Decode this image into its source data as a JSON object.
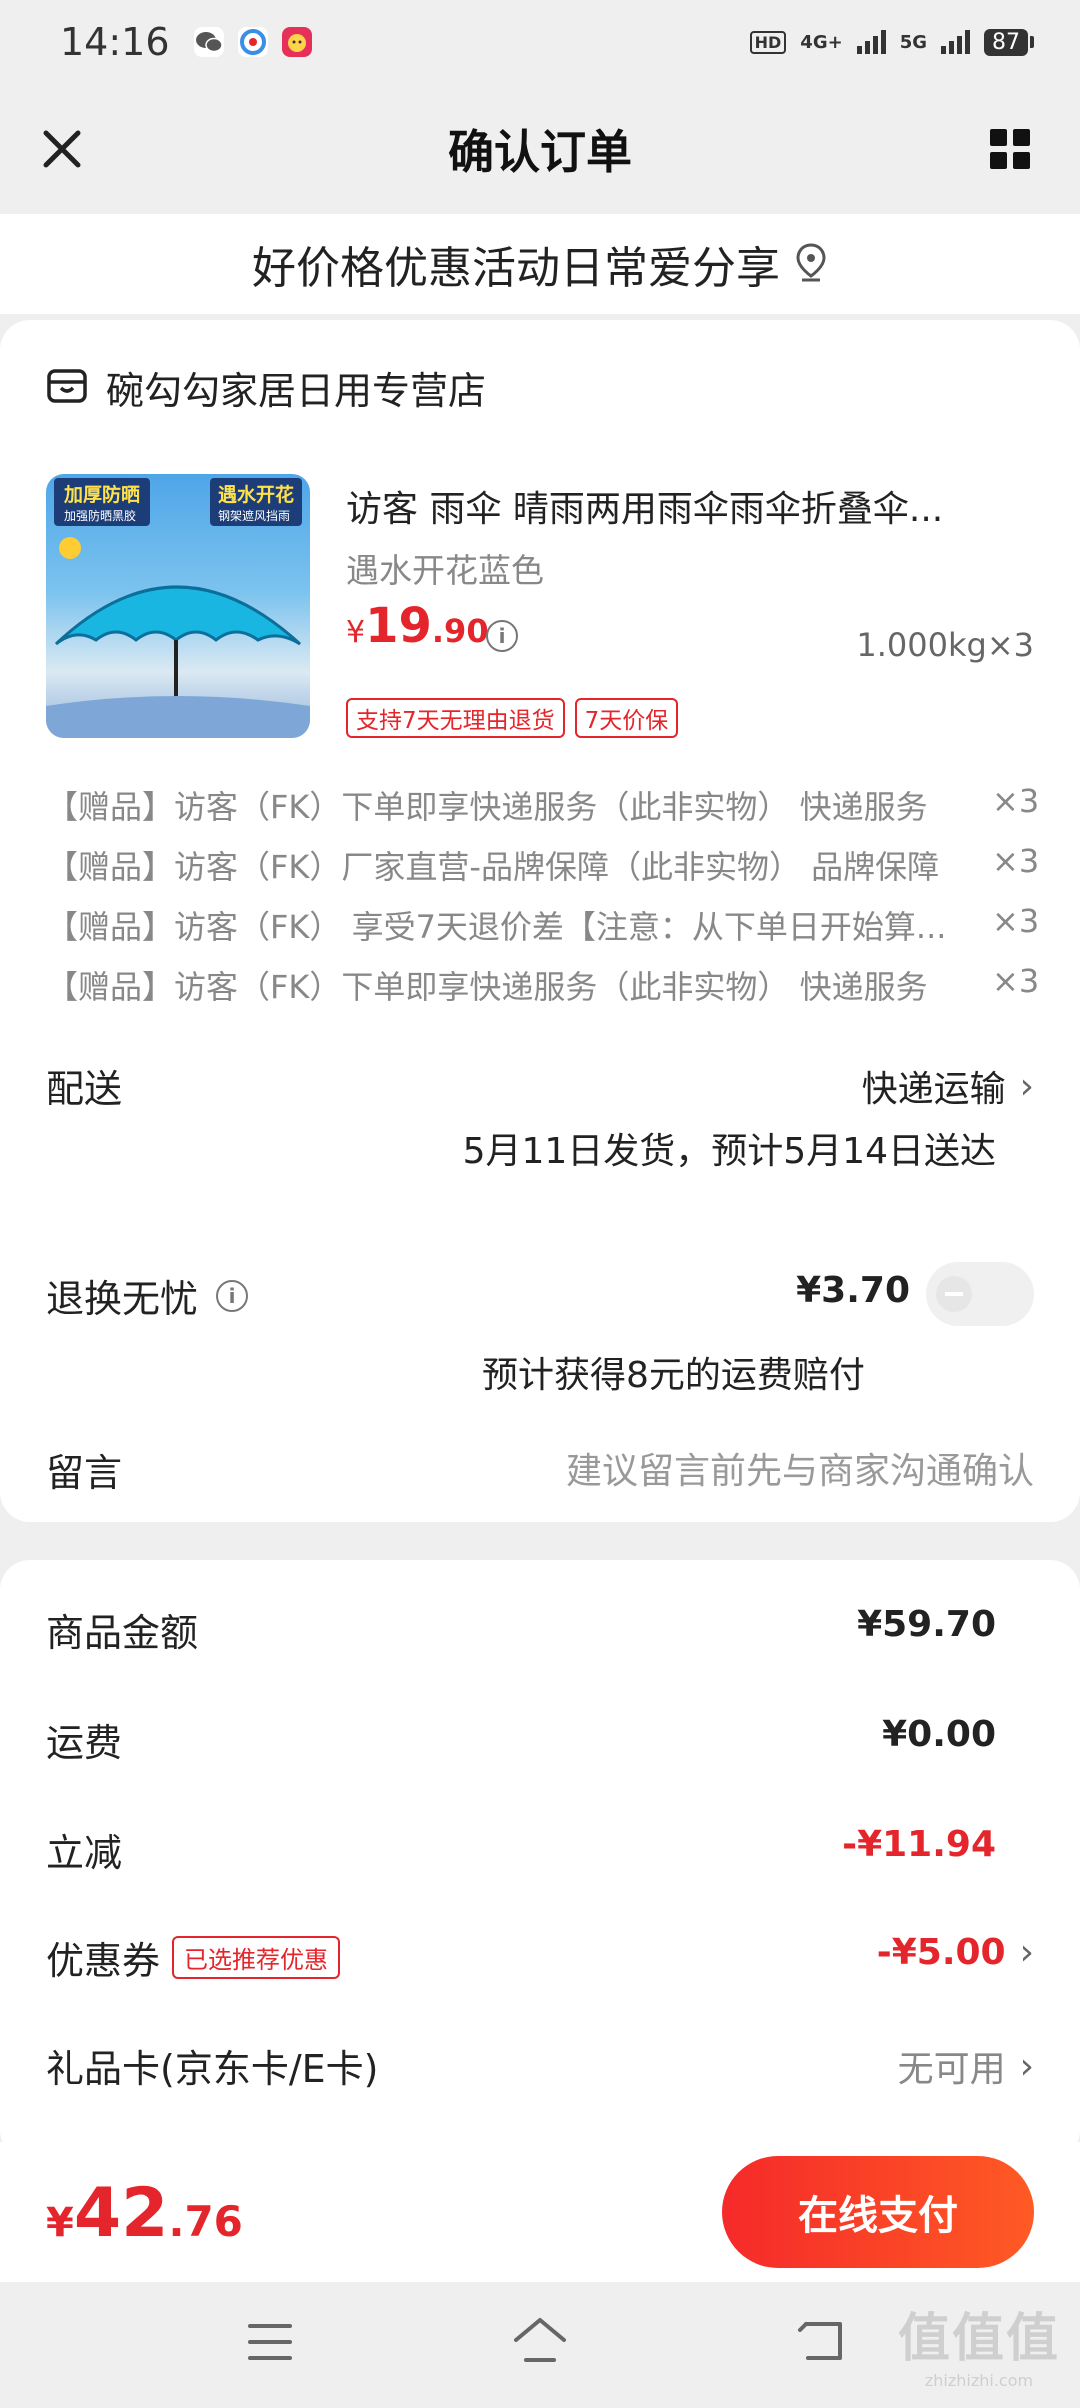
{
  "status_bar": {
    "time": "14:16",
    "network_1": "4G+",
    "network_2": "5G",
    "battery": "87"
  },
  "nav": {
    "title": "确认订单"
  },
  "banner": {
    "text": "好价格优惠活动日常爱分享"
  },
  "shop": {
    "name": "碗勾勾家居日用专营店"
  },
  "product": {
    "image_tag_left": "加厚防晒",
    "image_tag_left_sub": "加强防晒黑胶",
    "image_tag_right": "遇水开花",
    "image_tag_right_sub": "钢架遮风挡雨",
    "title": "访客 雨伞 晴雨两用雨伞雨伞折叠伞...",
    "spec": "遇水开花蓝色",
    "price_symbol": "¥",
    "price_int": "19",
    "price_dec": ".90",
    "weight_qty": "1.000kg×3",
    "tags": [
      "支持7天无理由退货",
      "7天价保"
    ]
  },
  "gifts": [
    {
      "text": "【赠品】访客（FK）下单即享快递服务（此非实物） 快递服务",
      "qty": "×3"
    },
    {
      "text": "【赠品】访客（FK）厂家直营-品牌保障（此非实物） 品牌保障",
      "qty": "×3"
    },
    {
      "text": "【赠品】访客（FK） 享受7天退价差【注意：从下单日开始算...",
      "qty": "×3"
    },
    {
      "text": "【赠品】访客（FK）下单即享快递服务（此非实物） 快递服务",
      "qty": "×3"
    }
  ],
  "delivery": {
    "label": "配送",
    "method": "快递运输",
    "schedule": "5月11日发货，预计5月14日送达"
  },
  "return_worry": {
    "label": "退换无忧",
    "price": "¥3.70",
    "note": "预计获得8元的运费赔付"
  },
  "message": {
    "label": "留言",
    "placeholder": "建议留言前先与商家沟通确认"
  },
  "summary": {
    "goods_label": "商品金额",
    "goods_value": "¥59.70",
    "freight_label": "运费",
    "freight_value": "¥0.00",
    "discount_label": "立减",
    "discount_value": "-¥11.94",
    "coupon_label": "优惠券",
    "coupon_badge": "已选推荐优惠",
    "coupon_value": "-¥5.00",
    "giftcard_label": "礼品卡(京东卡/E卡)",
    "giftcard_value": "无可用"
  },
  "pay": {
    "symbol": "¥",
    "int": "42",
    "dec": ".76",
    "button": "在线支付"
  },
  "watermark": {
    "big": "值值值",
    "small": "zhizhizhi.com"
  },
  "colors": {
    "accent_red": "#e4252b",
    "pay_gradient_start": "#f52a2a",
    "pay_gradient_end": "#ff5a24"
  }
}
